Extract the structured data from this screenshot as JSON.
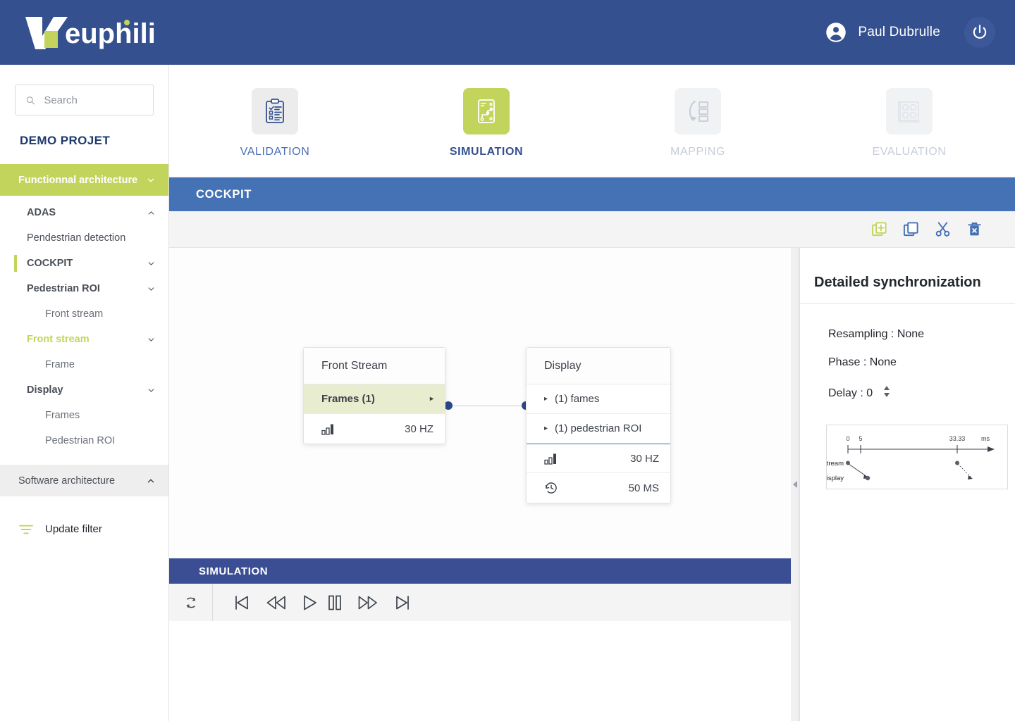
{
  "header": {
    "brand": "euphilia",
    "user_name": "Paul Dubrulle",
    "user_icon": "account-circle-icon",
    "power_icon": "power-icon",
    "brand_color": "#34508f",
    "accent_green": "#c3d45d"
  },
  "sidebar": {
    "search": {
      "placeholder": "Search",
      "value": "",
      "icon": "search-icon"
    },
    "project_title": "DEMO PROJET",
    "sections": [
      {
        "label": "Functionnal architecture",
        "state": "expanded",
        "chevron": "chevron-down-icon"
      },
      {
        "label": "Software architecture",
        "state": "collapsed",
        "chevron": "chevron-up-icon"
      }
    ],
    "tree": [
      {
        "label": "ADAS",
        "level": 1,
        "chevron": "chevron-up-icon",
        "selected": false,
        "green": false
      },
      {
        "label": "Pendestrian detection",
        "level": 2,
        "chevron": "",
        "selected": false,
        "green": false
      },
      {
        "label": "COCKPIT",
        "level": 1,
        "chevron": "chevron-down-icon",
        "selected": true,
        "green": false
      },
      {
        "label": "Pedestrian ROI",
        "level": 1,
        "chevron": "chevron-down-icon",
        "selected": false,
        "green": false
      },
      {
        "label": "Front stream",
        "level": 3,
        "chevron": "",
        "selected": false,
        "green": false
      },
      {
        "label": "Front stream",
        "level": 1,
        "chevron": "chevron-down-icon",
        "selected": false,
        "green": true
      },
      {
        "label": "Frame",
        "level": 3,
        "chevron": "",
        "selected": false,
        "green": false
      },
      {
        "label": "Display",
        "level": 1,
        "chevron": "chevron-down-icon",
        "selected": false,
        "green": false
      },
      {
        "label": "Frames",
        "level": 3,
        "chevron": "",
        "selected": false,
        "green": false
      },
      {
        "label": "Pedestrian ROI",
        "level": 3,
        "chevron": "",
        "selected": false,
        "green": false
      }
    ],
    "update_filter": {
      "label": "Update filter",
      "icon": "filter-icon"
    }
  },
  "topnav": {
    "tabs": [
      {
        "label": "VALIDATION",
        "icon": "clipboard-check-icon",
        "state": "inactive"
      },
      {
        "label": "SIMULATION",
        "icon": "simulation-flow-icon",
        "state": "active"
      },
      {
        "label": "MAPPING",
        "icon": "mapping-arrow-icon",
        "state": "disabled"
      },
      {
        "label": "EVALUATION",
        "icon": "evaluation-grid-icon",
        "state": "disabled"
      }
    ]
  },
  "content": {
    "title": "COCKPIT",
    "toolbar": [
      {
        "name": "add-icon",
        "label": "Add"
      },
      {
        "name": "copy-icon",
        "label": "Copy"
      },
      {
        "name": "cut-icon",
        "label": "Cut"
      },
      {
        "name": "delete-icon",
        "label": "Delete"
      }
    ]
  },
  "diagram": {
    "nodes": [
      {
        "title": "Front Stream",
        "rows": [
          {
            "label": "Frames (1)",
            "value": "",
            "selected": true,
            "expander": "▸",
            "icon": ""
          },
          {
            "label": "",
            "value": "30 HZ",
            "selected": false,
            "expander": "",
            "icon": "bar-chart-icon"
          }
        ]
      },
      {
        "title": "Display",
        "rows": [
          {
            "label": "(1)  fames",
            "value": "",
            "selected": false,
            "expander": "▸",
            "icon": ""
          },
          {
            "label": "(1) pedestrian ROI",
            "value": "",
            "selected": false,
            "expander": "▸",
            "icon": ""
          },
          {
            "label": "",
            "value": "30 HZ",
            "selected": false,
            "expander": "",
            "icon": "bar-chart-icon"
          },
          {
            "label": "",
            "value": "50 MS",
            "selected": false,
            "expander": "",
            "icon": "history-icon"
          }
        ]
      }
    ]
  },
  "simulation": {
    "title": "SIMULATION",
    "controls": [
      {
        "name": "loop-icon",
        "label": "Loop"
      },
      {
        "name": "skip-previous-icon",
        "label": "Skip to start"
      },
      {
        "name": "rewind-icon",
        "label": "Rewind"
      },
      {
        "name": "play-icon",
        "label": "Play"
      },
      {
        "name": "pause-icon",
        "label": "Pause"
      },
      {
        "name": "fast-forward-icon",
        "label": "Fast forward"
      },
      {
        "name": "skip-next-icon",
        "label": "Skip to end"
      }
    ]
  },
  "right_panel": {
    "title": "Detailed synchronization",
    "resampling": "Resampling : None",
    "phase": "Phase : None",
    "delay": "Delay : 0",
    "stepper_icon": "stepper-up-down-icon",
    "timeline": {
      "unit": "ms",
      "ticks": [
        "0",
        "5",
        "33.33"
      ],
      "rows": [
        "Front Stream",
        "Display"
      ]
    }
  },
  "collapse_handle": {
    "icon": "chevron-left-icon"
  }
}
